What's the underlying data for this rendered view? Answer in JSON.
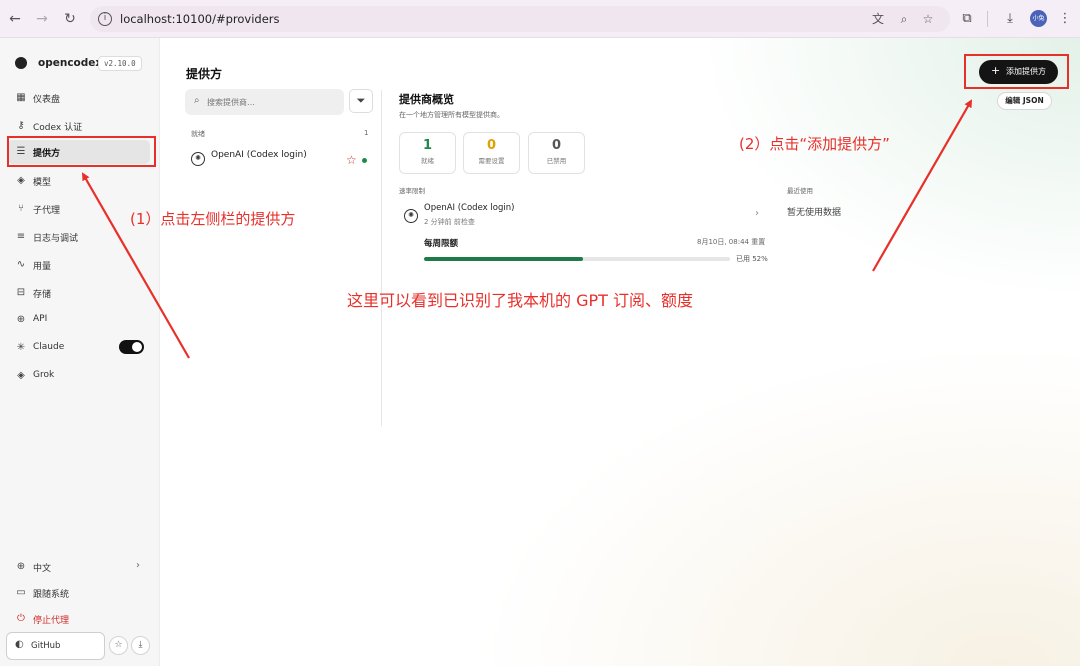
{
  "browser": {
    "url": "localhost:10100/#providers",
    "avatar_label": "小兔"
  },
  "sidebar": {
    "app_name": "opencodex",
    "version": "v2.10.0",
    "items": [
      {
        "label": "仪表盘",
        "icon": "dashboard-icon"
      },
      {
        "label": "Codex 认证",
        "icon": "key-icon"
      },
      {
        "label": "提供方",
        "icon": "server-icon"
      },
      {
        "label": "模型",
        "icon": "cube-icon"
      },
      {
        "label": "子代理",
        "icon": "tree-icon"
      },
      {
        "label": "日志与调试",
        "icon": "list-icon"
      },
      {
        "label": "用量",
        "icon": "activity-icon"
      },
      {
        "label": "存储",
        "icon": "drive-icon"
      },
      {
        "label": "API",
        "icon": "globe-icon"
      },
      {
        "label": "Claude",
        "icon": "asterisk-icon",
        "toggle_on": true
      },
      {
        "label": "Grok",
        "icon": "cube-icon"
      }
    ],
    "language": "中文",
    "tracking": "跟随系统",
    "stop_proxy": "停止代理",
    "github": "GitHub"
  },
  "providers": {
    "title": "提供方",
    "search_placeholder": "搜索提供商…",
    "group_label": "就绪",
    "group_count": "1",
    "items": [
      {
        "name": "OpenAI (Codex login)"
      }
    ]
  },
  "overview": {
    "title": "提供商概览",
    "subtitle": "在一个地方管理所有模型提供商。",
    "stats": [
      {
        "value": "1",
        "label": "就绪",
        "color": "#1e8a4a"
      },
      {
        "value": "0",
        "label": "需要设置",
        "color": "#e0a000"
      },
      {
        "value": "0",
        "label": "已禁用",
        "color": "#555555"
      }
    ],
    "rate_limits_label": "速率限制",
    "recent_label": "最近使用",
    "recent_empty": "暂无使用数据",
    "rate_row": {
      "name": "OpenAI (Codex login)",
      "checked": "2 分钟前 前检查",
      "quota_label": "每周限额",
      "reset": "8月10日, 08:44 重置",
      "used_text": "已用 52%",
      "used_fraction": 0.52
    }
  },
  "actions": {
    "add_provider": "添加提供方",
    "edit_json": "编辑 JSON"
  },
  "annotations": {
    "step1": "(1）点击左侧栏的提供方",
    "step2": "(2）点击“添加提供方”",
    "note": "这里可以看到已识别了我本机的 GPT 订阅、额度",
    "color": "#e8302b"
  }
}
